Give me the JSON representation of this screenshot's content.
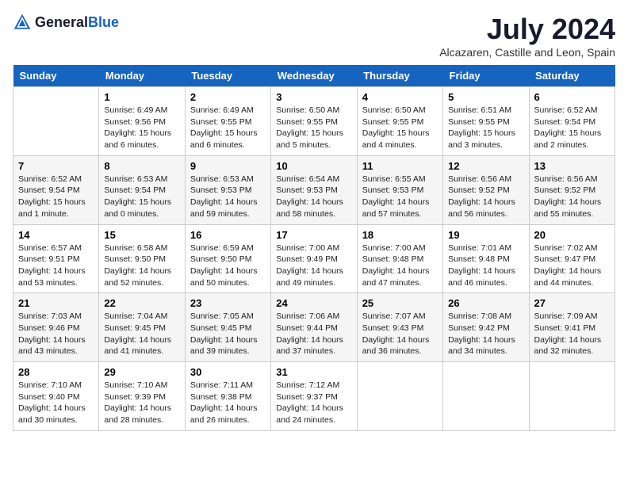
{
  "logo": {
    "text_general": "General",
    "text_blue": "Blue"
  },
  "title": "July 2024",
  "location": "Alcazaren, Castille and Leon, Spain",
  "headers": [
    "Sunday",
    "Monday",
    "Tuesday",
    "Wednesday",
    "Thursday",
    "Friday",
    "Saturday"
  ],
  "weeks": [
    [
      {
        "date": "",
        "sunrise": "",
        "sunset": "",
        "daylight": ""
      },
      {
        "date": "1",
        "sunrise": "Sunrise: 6:49 AM",
        "sunset": "Sunset: 9:56 PM",
        "daylight": "Daylight: 15 hours and 6 minutes."
      },
      {
        "date": "2",
        "sunrise": "Sunrise: 6:49 AM",
        "sunset": "Sunset: 9:55 PM",
        "daylight": "Daylight: 15 hours and 6 minutes."
      },
      {
        "date": "3",
        "sunrise": "Sunrise: 6:50 AM",
        "sunset": "Sunset: 9:55 PM",
        "daylight": "Daylight: 15 hours and 5 minutes."
      },
      {
        "date": "4",
        "sunrise": "Sunrise: 6:50 AM",
        "sunset": "Sunset: 9:55 PM",
        "daylight": "Daylight: 15 hours and 4 minutes."
      },
      {
        "date": "5",
        "sunrise": "Sunrise: 6:51 AM",
        "sunset": "Sunset: 9:55 PM",
        "daylight": "Daylight: 15 hours and 3 minutes."
      },
      {
        "date": "6",
        "sunrise": "Sunrise: 6:52 AM",
        "sunset": "Sunset: 9:54 PM",
        "daylight": "Daylight: 15 hours and 2 minutes."
      }
    ],
    [
      {
        "date": "7",
        "sunrise": "Sunrise: 6:52 AM",
        "sunset": "Sunset: 9:54 PM",
        "daylight": "Daylight: 15 hours and 1 minute."
      },
      {
        "date": "8",
        "sunrise": "Sunrise: 6:53 AM",
        "sunset": "Sunset: 9:54 PM",
        "daylight": "Daylight: 15 hours and 0 minutes."
      },
      {
        "date": "9",
        "sunrise": "Sunrise: 6:53 AM",
        "sunset": "Sunset: 9:53 PM",
        "daylight": "Daylight: 14 hours and 59 minutes."
      },
      {
        "date": "10",
        "sunrise": "Sunrise: 6:54 AM",
        "sunset": "Sunset: 9:53 PM",
        "daylight": "Daylight: 14 hours and 58 minutes."
      },
      {
        "date": "11",
        "sunrise": "Sunrise: 6:55 AM",
        "sunset": "Sunset: 9:53 PM",
        "daylight": "Daylight: 14 hours and 57 minutes."
      },
      {
        "date": "12",
        "sunrise": "Sunrise: 6:56 AM",
        "sunset": "Sunset: 9:52 PM",
        "daylight": "Daylight: 14 hours and 56 minutes."
      },
      {
        "date": "13",
        "sunrise": "Sunrise: 6:56 AM",
        "sunset": "Sunset: 9:52 PM",
        "daylight": "Daylight: 14 hours and 55 minutes."
      }
    ],
    [
      {
        "date": "14",
        "sunrise": "Sunrise: 6:57 AM",
        "sunset": "Sunset: 9:51 PM",
        "daylight": "Daylight: 14 hours and 53 minutes."
      },
      {
        "date": "15",
        "sunrise": "Sunrise: 6:58 AM",
        "sunset": "Sunset: 9:50 PM",
        "daylight": "Daylight: 14 hours and 52 minutes."
      },
      {
        "date": "16",
        "sunrise": "Sunrise: 6:59 AM",
        "sunset": "Sunset: 9:50 PM",
        "daylight": "Daylight: 14 hours and 50 minutes."
      },
      {
        "date": "17",
        "sunrise": "Sunrise: 7:00 AM",
        "sunset": "Sunset: 9:49 PM",
        "daylight": "Daylight: 14 hours and 49 minutes."
      },
      {
        "date": "18",
        "sunrise": "Sunrise: 7:00 AM",
        "sunset": "Sunset: 9:48 PM",
        "daylight": "Daylight: 14 hours and 47 minutes."
      },
      {
        "date": "19",
        "sunrise": "Sunrise: 7:01 AM",
        "sunset": "Sunset: 9:48 PM",
        "daylight": "Daylight: 14 hours and 46 minutes."
      },
      {
        "date": "20",
        "sunrise": "Sunrise: 7:02 AM",
        "sunset": "Sunset: 9:47 PM",
        "daylight": "Daylight: 14 hours and 44 minutes."
      }
    ],
    [
      {
        "date": "21",
        "sunrise": "Sunrise: 7:03 AM",
        "sunset": "Sunset: 9:46 PM",
        "daylight": "Daylight: 14 hours and 43 minutes."
      },
      {
        "date": "22",
        "sunrise": "Sunrise: 7:04 AM",
        "sunset": "Sunset: 9:45 PM",
        "daylight": "Daylight: 14 hours and 41 minutes."
      },
      {
        "date": "23",
        "sunrise": "Sunrise: 7:05 AM",
        "sunset": "Sunset: 9:45 PM",
        "daylight": "Daylight: 14 hours and 39 minutes."
      },
      {
        "date": "24",
        "sunrise": "Sunrise: 7:06 AM",
        "sunset": "Sunset: 9:44 PM",
        "daylight": "Daylight: 14 hours and 37 minutes."
      },
      {
        "date": "25",
        "sunrise": "Sunrise: 7:07 AM",
        "sunset": "Sunset: 9:43 PM",
        "daylight": "Daylight: 14 hours and 36 minutes."
      },
      {
        "date": "26",
        "sunrise": "Sunrise: 7:08 AM",
        "sunset": "Sunset: 9:42 PM",
        "daylight": "Daylight: 14 hours and 34 minutes."
      },
      {
        "date": "27",
        "sunrise": "Sunrise: 7:09 AM",
        "sunset": "Sunset: 9:41 PM",
        "daylight": "Daylight: 14 hours and 32 minutes."
      }
    ],
    [
      {
        "date": "28",
        "sunrise": "Sunrise: 7:10 AM",
        "sunset": "Sunset: 9:40 PM",
        "daylight": "Daylight: 14 hours and 30 minutes."
      },
      {
        "date": "29",
        "sunrise": "Sunrise: 7:10 AM",
        "sunset": "Sunset: 9:39 PM",
        "daylight": "Daylight: 14 hours and 28 minutes."
      },
      {
        "date": "30",
        "sunrise": "Sunrise: 7:11 AM",
        "sunset": "Sunset: 9:38 PM",
        "daylight": "Daylight: 14 hours and 26 minutes."
      },
      {
        "date": "31",
        "sunrise": "Sunrise: 7:12 AM",
        "sunset": "Sunset: 9:37 PM",
        "daylight": "Daylight: 14 hours and 24 minutes."
      },
      {
        "date": "",
        "sunrise": "",
        "sunset": "",
        "daylight": ""
      },
      {
        "date": "",
        "sunrise": "",
        "sunset": "",
        "daylight": ""
      },
      {
        "date": "",
        "sunrise": "",
        "sunset": "",
        "daylight": ""
      }
    ]
  ]
}
